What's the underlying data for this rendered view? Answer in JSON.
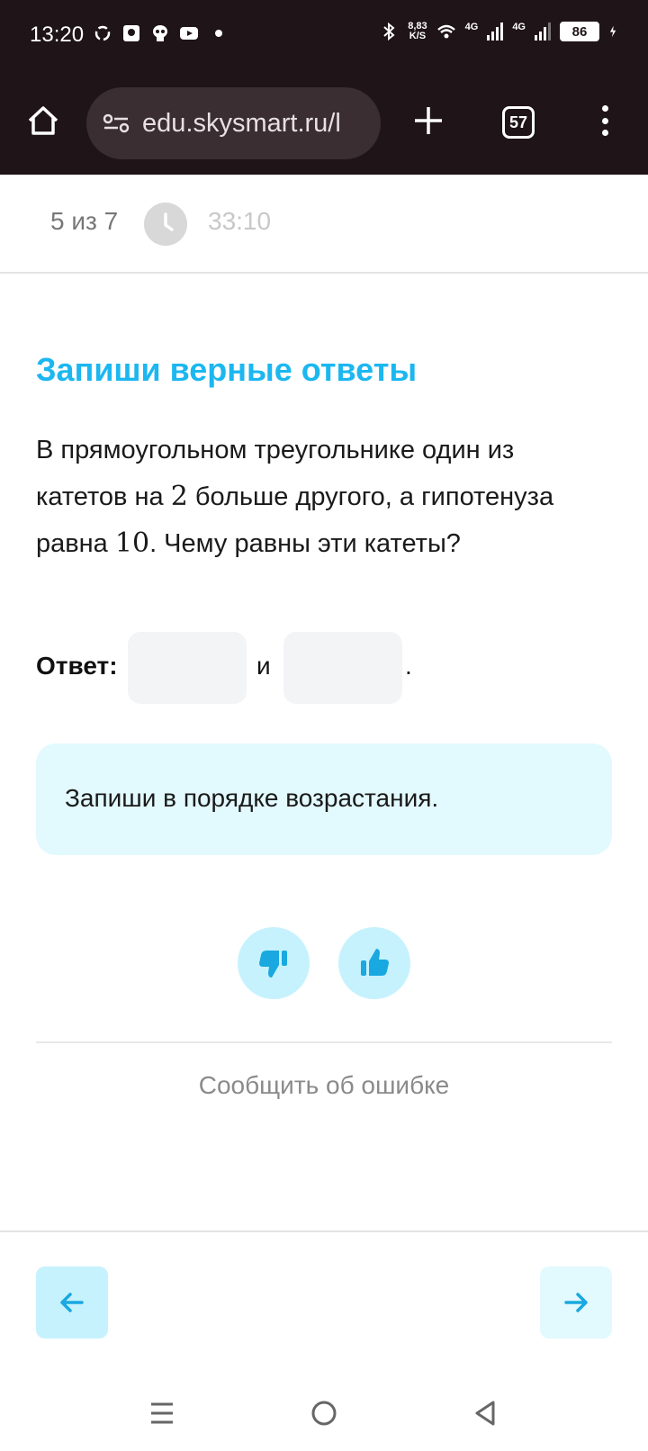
{
  "status_bar": {
    "time": "13:20",
    "speed_value": "8,83",
    "speed_unit": "K/S",
    "network_1": "4G",
    "network_2": "4G",
    "battery": "86"
  },
  "browser": {
    "url": "edu.skysmart.ru/l",
    "tab_count": "57"
  },
  "progress": {
    "count": "5 из 7",
    "timer": "33:10"
  },
  "task": {
    "title": "Запиши верные ответы",
    "text_part1": "В прямоугольном треугольнике один из катетов на ",
    "num1": "2",
    "text_part2": " больше другого, а гипотенуза равна ",
    "num2": "10",
    "text_part3": ". Чему равны эти катеты?"
  },
  "answer": {
    "label": "Ответ:",
    "value_1": "",
    "value_2": "",
    "conjunction": "и",
    "end": "."
  },
  "hint": {
    "text": "Запиши в порядке возрастания."
  },
  "feedback": {
    "report_label": "Сообщить об ошибке"
  },
  "colors": {
    "accent": "#1cb7f0",
    "vote_bg": "#c6f2fd",
    "hint_bg": "#e2f9fe",
    "icon_blue": "#1aa8e0",
    "topbar_bg": "#1f1418"
  }
}
